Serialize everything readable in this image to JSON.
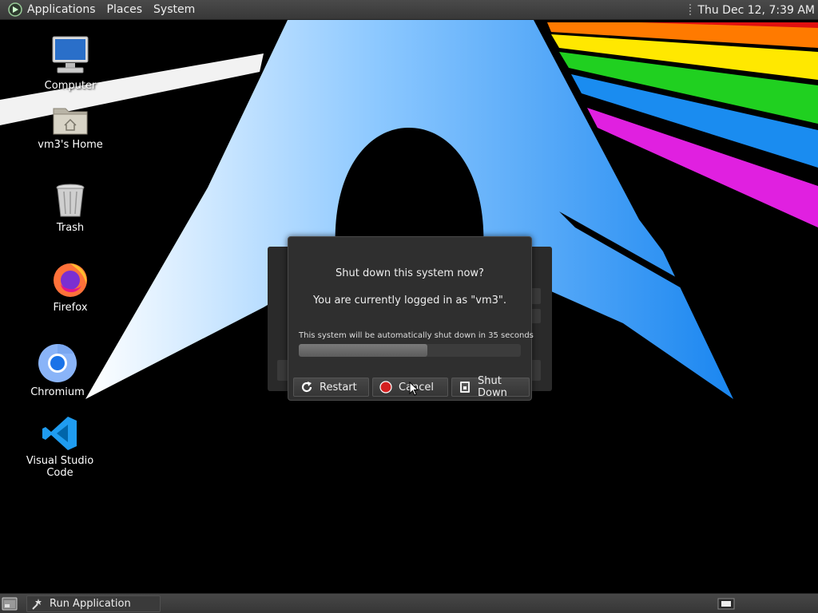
{
  "top_panel": {
    "menus": [
      "Applications",
      "Places",
      "System"
    ],
    "clock": "Thu Dec 12,  7:39 AM"
  },
  "desktop_icons": [
    {
      "label": "Computer",
      "icon": "computer-icon"
    },
    {
      "label": "vm3's Home",
      "icon": "home-folder-icon"
    },
    {
      "label": "Trash",
      "icon": "trash-icon"
    },
    {
      "label": "Firefox",
      "icon": "firefox-icon"
    },
    {
      "label": "Chromium",
      "icon": "chromium-icon"
    },
    {
      "label": "Visual Studio Code",
      "icon": "vscode-icon"
    }
  ],
  "dialog": {
    "title": "Shut down this system now?",
    "subtitle": "You are currently logged in as \"vm3\".",
    "countdown": "This system will be automatically shut down in 35 seconds",
    "progress": 0.58,
    "buttons": {
      "restart": "Restart",
      "cancel": "Cancel",
      "shutdown": "Shut Down"
    }
  },
  "bottom_panel": {
    "task": "Run Application"
  },
  "colors": {
    "panel": "#3e3e3e",
    "dialog_bg": "#2f2f2f",
    "cancel_red": "#d42020",
    "arch_blue": "#1e90ff"
  }
}
